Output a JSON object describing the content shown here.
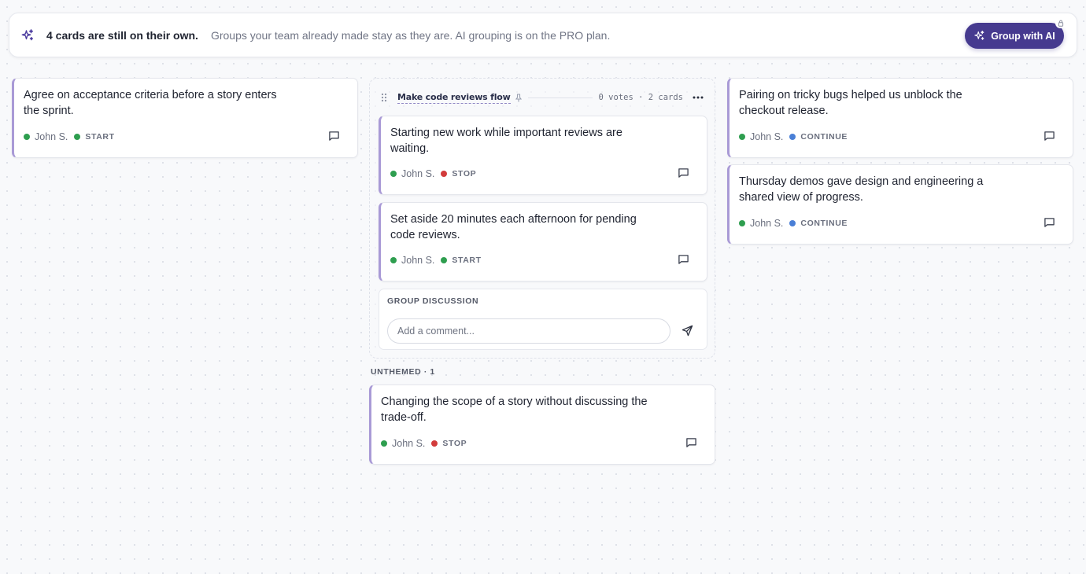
{
  "banner": {
    "headline": "4 cards are still on their own.",
    "subtext": "Groups your team already made stay as they are. AI grouping is on the PRO plan.",
    "button_label": "Group with AI",
    "icon": "sparkles-icon"
  },
  "colors": {
    "accent": "#463a8f",
    "card_border": "#a99ad6",
    "author_dot": "#2e9e4f",
    "start": "#2e9e4f",
    "stop": "#d23b3b",
    "continue": "#4a7fd6"
  },
  "left_column": {
    "cards": [
      {
        "text": "Agree on acceptance criteria before a story enters the sprint.",
        "author": "John S.",
        "type": "START"
      }
    ]
  },
  "group": {
    "title": "Make code reviews flow",
    "stats": "0 votes · 2 cards",
    "cards": [
      {
        "text": "Starting new work while important reviews are waiting.",
        "author": "John S.",
        "type": "STOP"
      },
      {
        "text": "Set aside 20 minutes each afternoon for pending code reviews.",
        "author": "John S.",
        "type": "START"
      }
    ],
    "discussion": {
      "label": "GROUP DISCUSSION",
      "placeholder": "Add a comment..."
    }
  },
  "unthemed": {
    "label": "UNTHEMED · 1",
    "cards": [
      {
        "text": "Changing the scope of a story without discussing the trade-off.",
        "author": "John S.",
        "type": "STOP"
      }
    ]
  },
  "right_column": {
    "cards": [
      {
        "text": "Pairing on tricky bugs helped us unblock the checkout release.",
        "author": "John S.",
        "type": "CONTINUE"
      },
      {
        "text": "Thursday demos gave design and engineering a shared view of progress.",
        "author": "John S.",
        "type": "CONTINUE"
      }
    ]
  }
}
